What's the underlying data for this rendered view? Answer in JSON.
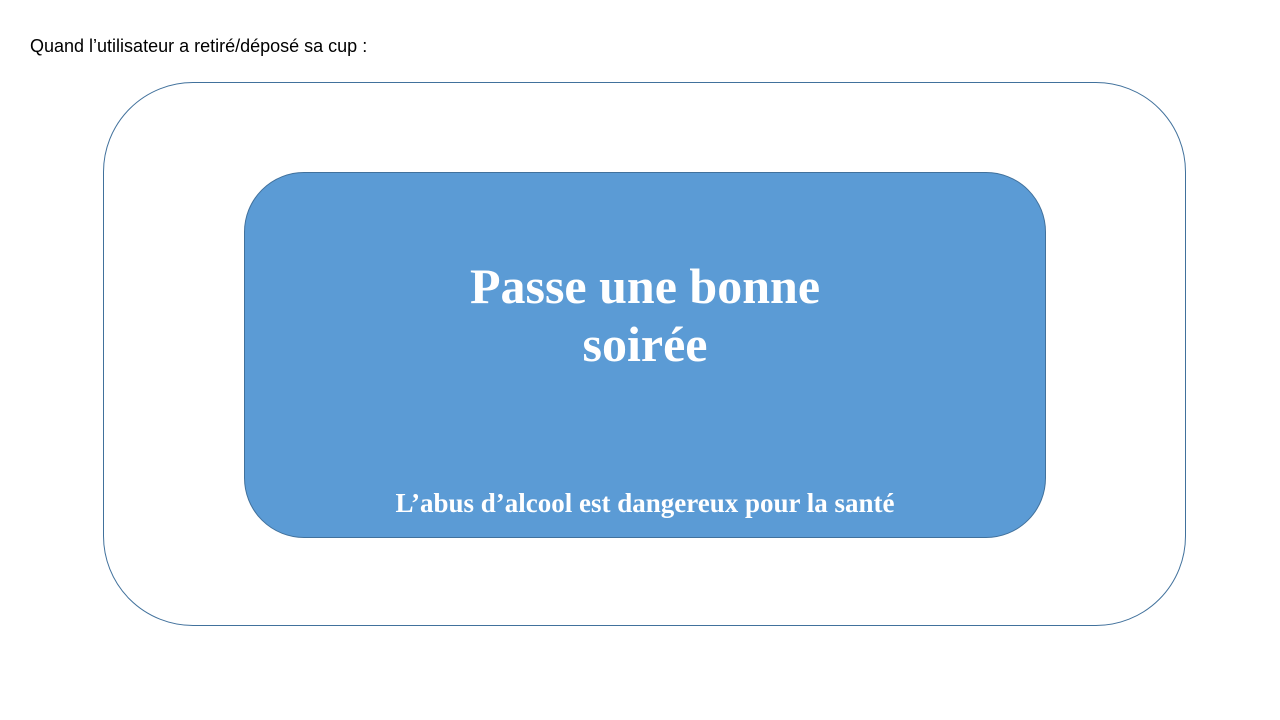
{
  "caption": "Quand l’utilisateur a retiré/déposé sa cup :",
  "screen": {
    "greeting_line1": "Passe une bonne",
    "greeting_line2": "soirée",
    "warning": "L’abus d’alcool est dangereux pour la santé"
  },
  "colors": {
    "panel_fill": "#5b9bd5",
    "frame_stroke": "#41719c",
    "panel_text": "#ffffff"
  }
}
